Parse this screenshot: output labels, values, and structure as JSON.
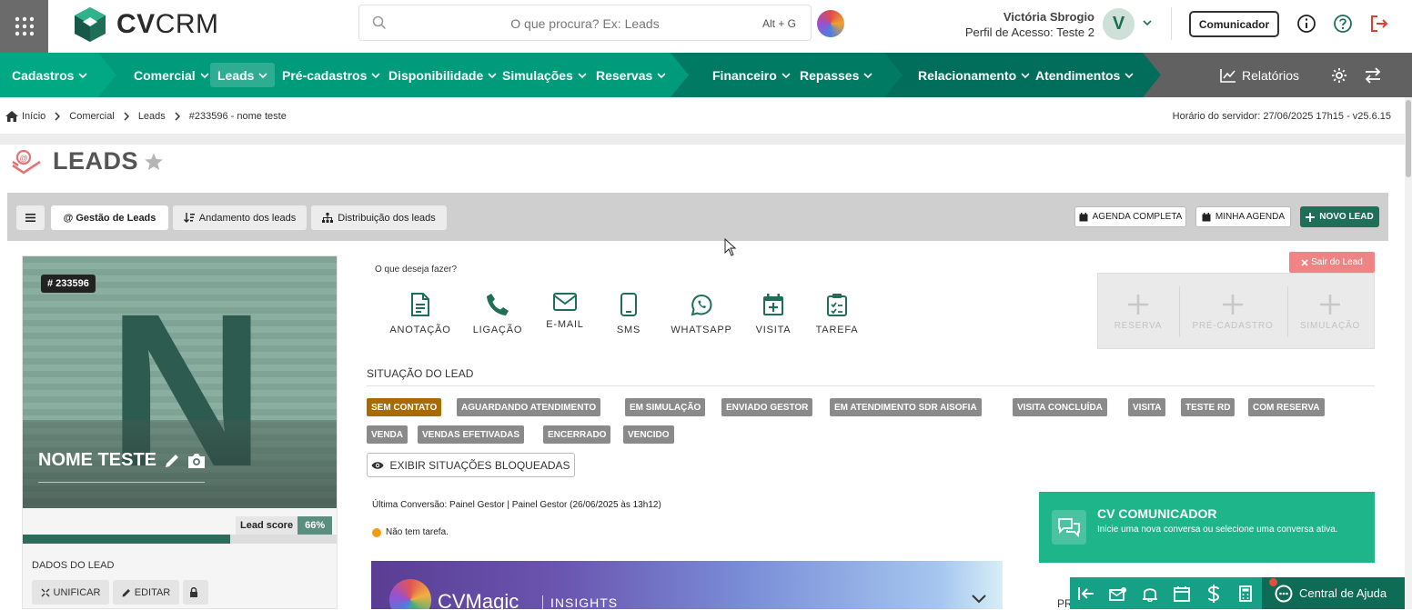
{
  "header": {
    "logo_text_bold": "CV",
    "logo_text_light": "CRM",
    "search_placeholder": "O que procura? Ex: Leads",
    "search_shortcut": "Alt + G",
    "user_name": "Victória Sbrogio",
    "user_profile": "Perfil de Acesso: Teste 2",
    "avatar_letter": "V",
    "comunicador_label": "Comunicador"
  },
  "nav": {
    "items": [
      {
        "label": "Cadastros"
      },
      {
        "label": "Comercial"
      },
      {
        "label": "Leads"
      },
      {
        "label": "Pré-cadastros"
      },
      {
        "label": "Disponibilidade"
      },
      {
        "label": "Simulações"
      },
      {
        "label": "Reservas"
      },
      {
        "label": "Financeiro"
      },
      {
        "label": "Repasses"
      },
      {
        "label": "Relacionamento"
      },
      {
        "label": "Atendimentos"
      }
    ],
    "relatorios": "Relatórios"
  },
  "breadcrumb": {
    "items": [
      "Início",
      "Comercial",
      "Leads",
      "#233596 - nome teste"
    ],
    "server_time": "Horário do servidor: 27/06/2025 17h15 - v25.6.15"
  },
  "page": {
    "title": "LEADS"
  },
  "toolbar": {
    "tabs": [
      "@ Gestão de Leads",
      "Andamento dos leads",
      "Distribuição dos leads"
    ],
    "agenda_completa": "AGENDA COMPLETA",
    "minha_agenda": "MINHA AGENDA",
    "novo_lead": "NOVO LEAD"
  },
  "lead": {
    "id": "# 233596",
    "initial": "N",
    "name": "NOME TESTE",
    "score_label": "Lead score",
    "score_value": "66%",
    "score_fraction": 0.66,
    "dados_label": "DADOS DO LEAD",
    "buttons": [
      "UNIFICAR",
      "EDITAR"
    ]
  },
  "actions": {
    "prompt": "O que deseja fazer?",
    "items": [
      "ANOTAÇÃO",
      "LIGAÇÃO",
      "E-MAIL",
      "SMS",
      "WHATSAPP",
      "VISITA",
      "TAREFA"
    ],
    "sair": "Sair do Lead",
    "quick": [
      "RESERVA",
      "PRÉ-CADASTRO",
      "SIMULAÇÃO"
    ]
  },
  "situacao": {
    "label": "SITUAÇÃO DO LEAD",
    "tags": [
      "SEM CONTATO",
      "AGUARDANDO ATENDIMENTO",
      "EM SIMULAÇÃO",
      "ENVIADO GESTOR",
      "EM ATENDIMENTO SDR AISOFIA",
      "VISITA CONCLUÍDA",
      "VISITA",
      "TESTE RD",
      "COM RESERVA",
      "VENDA",
      "VENDAS EFETIVADAS",
      "ENCERRADO",
      "VENCIDO"
    ],
    "active_tag": "SEM CONTATO",
    "bloqueadas": "EXIBIR SITUAÇÕES BLOQUEADAS"
  },
  "info": {
    "ultima_conversao": "Última Conversão: Painel Gestor | Painel Gestor (26/06/2025 às 13h12)",
    "tarefa": "Não tem tarefa."
  },
  "cvmagic": {
    "title": "CVMagic",
    "subtitle": "INSIGHTS"
  },
  "comunicador": {
    "title": "CV COMUNICADOR",
    "desc": "Inicie uma nova conversa ou selecione uma conversa ativa."
  },
  "side_label": "PR",
  "help": {
    "label": "Central de Ajuda"
  },
  "colors": {
    "nav_green": "#00a884",
    "nav_dark_green": "#006e5a",
    "active_tag": "#a96b00",
    "brand_dark": "#1f6e57"
  }
}
